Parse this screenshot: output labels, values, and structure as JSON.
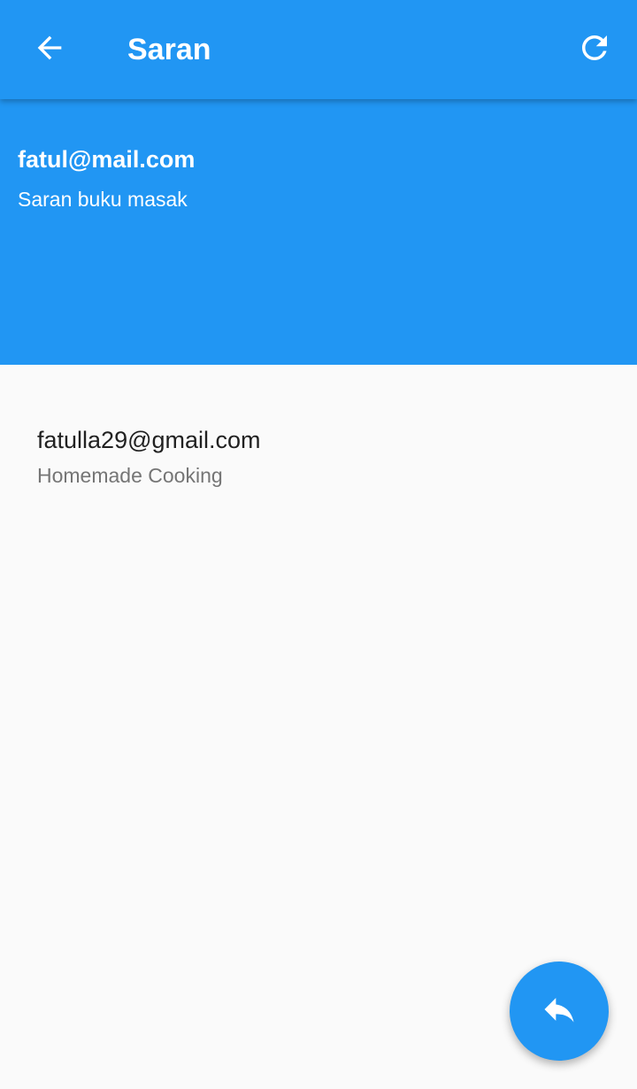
{
  "app_bar": {
    "title": "Saran",
    "back_icon": "arrow-back-icon",
    "refresh_icon": "refresh-icon",
    "background_color": "#2196f3"
  },
  "header": {
    "email": "fatul@mail.com",
    "subject": "Saran buku masak"
  },
  "list": {
    "items": [
      {
        "title": "fatulla29@gmail.com",
        "subtitle": "Homemade Cooking"
      }
    ]
  },
  "fab": {
    "icon": "reply-icon",
    "color": "#2196f3"
  }
}
